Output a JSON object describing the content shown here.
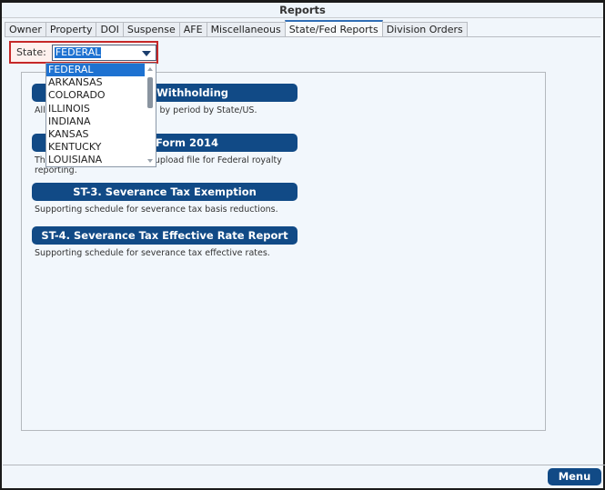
{
  "window": {
    "title": "Reports"
  },
  "tabs": [
    {
      "label": "Owner",
      "active": false
    },
    {
      "label": "Property",
      "active": false
    },
    {
      "label": "DOI",
      "active": false
    },
    {
      "label": "Suspense",
      "active": false
    },
    {
      "label": "AFE",
      "active": false
    },
    {
      "label": "Miscellaneous",
      "active": false
    },
    {
      "label": "State/Fed Reports",
      "active": true
    },
    {
      "label": "Division Orders",
      "active": false
    }
  ],
  "state_filter": {
    "label": "State:",
    "selected": "FEDERAL",
    "options": [
      "FEDERAL",
      "ARKANSAS",
      "COLORADO",
      "ILLINOIS",
      "INDIANA",
      "KANSAS",
      "KENTUCKY",
      "LOUISIANA"
    ]
  },
  "reports": [
    {
      "title": "ST-1. State Withholding Withholding",
      "visible_title": "p Withholding",
      "description": "All... ...ing by period by State/US."
    },
    {
      "title": "ONRR Form 2014",
      "visible_title": "RR Form 2014",
      "description": "Th... ...d upload file for Federal royalty reporting."
    },
    {
      "title": "ST-3. Severance Tax Exemption",
      "visible_title": "ST-3. Severance Tax Exemption",
      "description": "Supporting schedule for severance tax basis reductions."
    },
    {
      "title": "ST-4. Severance Tax Effective Rate Report",
      "visible_title": "ST-4. Severance Tax Effective Rate Report",
      "description": "Supporting schedule for severance tax effective rates."
    }
  ],
  "report_texts": {
    "r1_btn_right": "p Withholding",
    "r1_desc_left": "All",
    "r1_desc_right": "ing by period by State/US.",
    "r2_btn_right": "RR Form 2014",
    "r2_desc_left": "Th",
    "r2_desc_right": "d upload file for Federal royalty",
    "r2_desc_line2": "reporting."
  },
  "footer": {
    "menu_label": "Menu"
  },
  "colors": {
    "accent": "#114a86",
    "selection": "#1e72d1",
    "highlight_border": "#c62828"
  }
}
